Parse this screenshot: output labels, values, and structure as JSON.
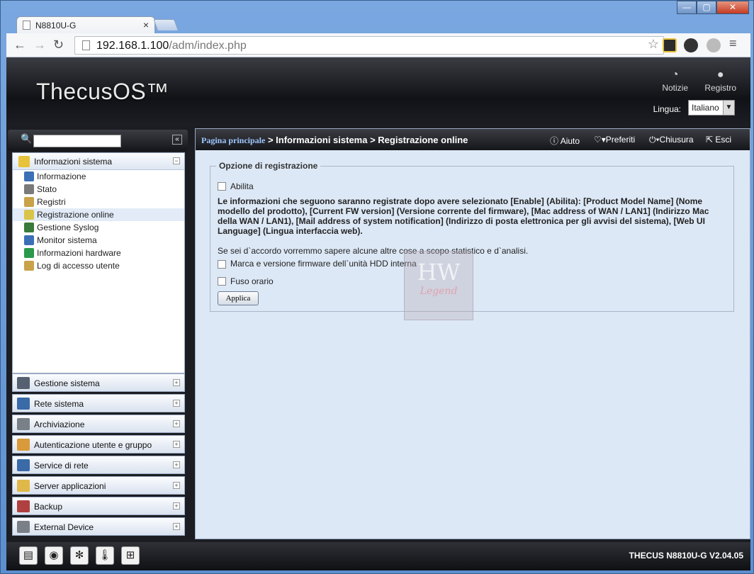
{
  "browser": {
    "tab_title": "N8810U-G",
    "tab_close": "×",
    "url_host": "192.168.1.100",
    "url_path": "/adm/index.php"
  },
  "header": {
    "logo": "ThecusOS™",
    "notifications_label": "Notizie",
    "log_label": "Registro",
    "language_label": "Lingua:",
    "language_value": "Italiano"
  },
  "sidebar": {
    "expanded_group": "Informazioni sistema",
    "items": [
      {
        "label": "Informazione",
        "color": "#3b6fb6"
      },
      {
        "label": "Stato",
        "color": "#7a7a7a"
      },
      {
        "label": "Registri",
        "color": "#c9a24a"
      },
      {
        "label": "Registrazione online",
        "color": "#d9c44a"
      },
      {
        "label": "Gestione Syslog",
        "color": "#3a7a3a"
      },
      {
        "label": "Monitor sistema",
        "color": "#3b6fb6"
      },
      {
        "label": "Informazioni hardware",
        "color": "#2a9a4a"
      },
      {
        "label": "Log di accesso utente",
        "color": "#c9a24a"
      }
    ],
    "groups": [
      {
        "label": "Gestione sistema",
        "color": "#556070"
      },
      {
        "label": "Rete sistema",
        "color": "#3a6aa8"
      },
      {
        "label": "Archiviazione",
        "color": "#7a8088"
      },
      {
        "label": "Autenticazione utente e gruppo",
        "color": "#d89a3a"
      },
      {
        "label": "Service di rete",
        "color": "#3a6aa8"
      },
      {
        "label": "Server applicazioni",
        "color": "#e0b84a"
      },
      {
        "label": "Backup",
        "color": "#b04040"
      },
      {
        "label": "External Device",
        "color": "#7a8088"
      }
    ]
  },
  "breadcrumb": {
    "home": "Pagina principale",
    "path": " > Informazioni sistema > Registrazione online"
  },
  "toolbar": {
    "help": "Aiuto",
    "favorites": "Preferiti",
    "shutdown": "Chiusura",
    "logout": "Esci"
  },
  "form": {
    "legend": "Opzione di registrazione",
    "enable_label": "Abilita",
    "info_text": "Le informazioni che seguono saranno registrate dopo avere selezionato [Enable] (Abilita): [Product Model Name] (Nome modello del prodotto), [Current FW version] (Versione corrente del firmware), [Mac address of WAN / LAN1] (Indirizzo Mac della WAN / LAN1), [Mail address of system notification] (Indirizzo di posta elettronica per gli avvisi del sistema), [Web UI Language] (Lingua interfaccia web).",
    "note": "Se sei d`accordo vorremmo sapere alcune altre cose a scopo statistico e d`analisi.",
    "hdd_label": "Marca e versione firmware dell`unità HDD interna",
    "timezone_label": "Fuso orario",
    "apply_button": "Applica"
  },
  "watermark": {
    "big": "HW",
    "small": "Legend"
  },
  "footer": {
    "version": "THECUS N8810U-G V2.04.05"
  }
}
